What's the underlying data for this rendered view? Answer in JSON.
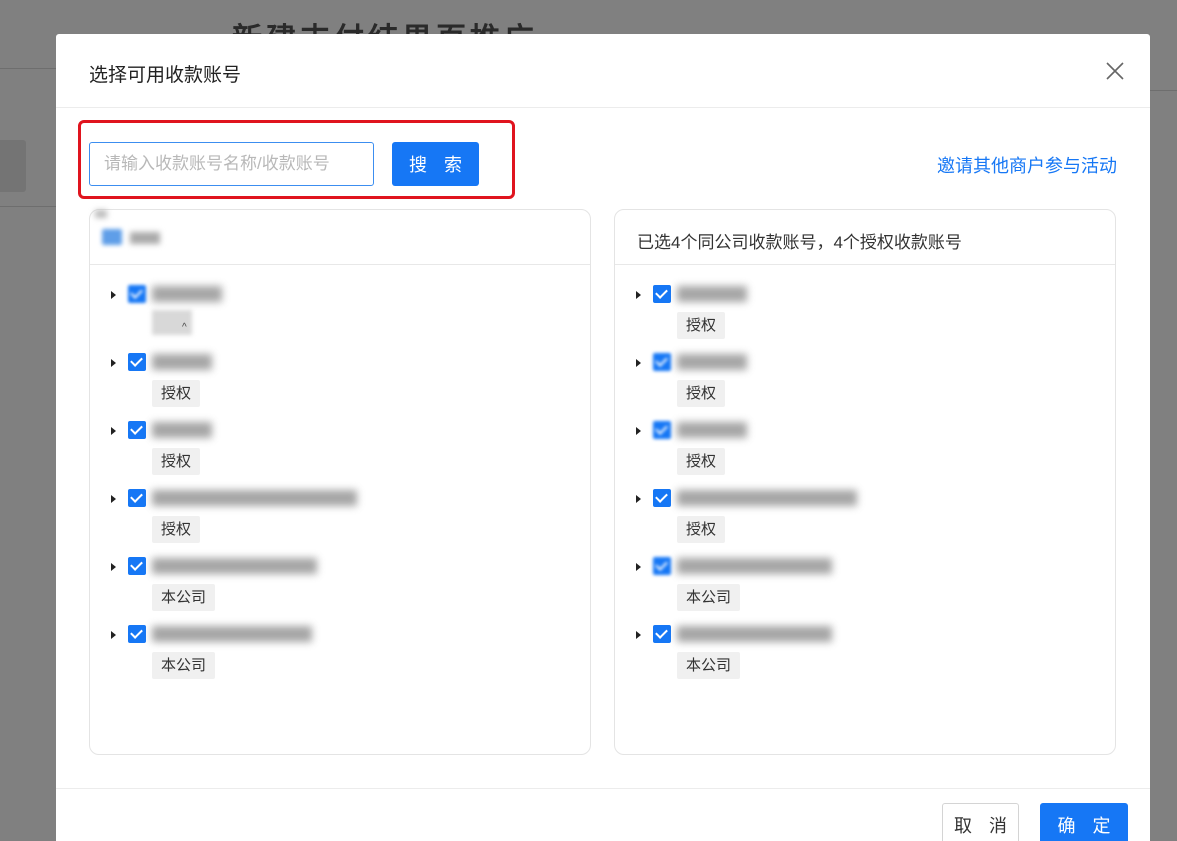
{
  "background": {
    "page_title": "新建支付结果页推广"
  },
  "modal": {
    "title": "选择可用收款账号",
    "search": {
      "placeholder": "请输入收款账号名称/收款账号",
      "value": "",
      "button_label": "搜 索"
    },
    "invite_link": "邀请其他商户参与活动",
    "left_panel": {
      "items": [
        {
          "tag": ""
        },
        {
          "tag": "授权"
        },
        {
          "tag": "授权"
        },
        {
          "tag": "授权"
        },
        {
          "tag": "本公司"
        },
        {
          "tag": "本公司"
        }
      ]
    },
    "right_panel": {
      "header": "已选4个同公司收款账号，4个授权收款账号",
      "items": [
        {
          "tag": "授权"
        },
        {
          "tag": "授权"
        },
        {
          "tag": "授权"
        },
        {
          "tag": "授权"
        },
        {
          "tag": "本公司"
        },
        {
          "tag": "本公司"
        }
      ]
    },
    "footer": {
      "cancel_label": "取 消",
      "ok_label": "确 定"
    }
  },
  "colors": {
    "primary": "#1677f5",
    "highlight": "#e0141e"
  },
  "icons": {
    "close": "close-icon",
    "caret": "caret-right-icon",
    "checkbox": "checkbox-checked-icon"
  }
}
